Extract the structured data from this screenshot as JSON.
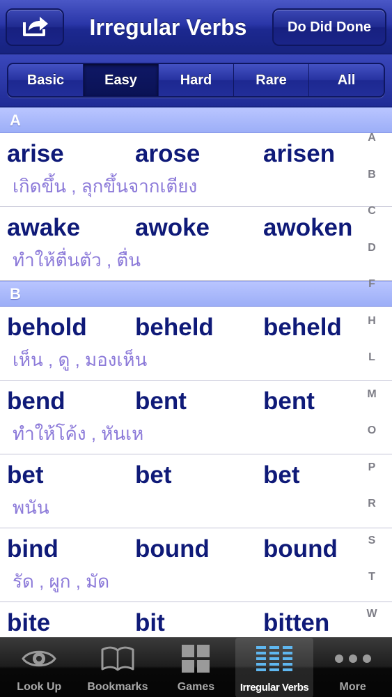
{
  "navbar": {
    "title": "Irregular Verbs",
    "share_icon": "share-arrow-icon",
    "right_button": "Do Did Done"
  },
  "segments": [
    {
      "label": "Basic",
      "selected": false
    },
    {
      "label": "Easy",
      "selected": true
    },
    {
      "label": "Hard",
      "selected": false
    },
    {
      "label": "Rare",
      "selected": false
    },
    {
      "label": "All",
      "selected": false
    }
  ],
  "sections": [
    {
      "letter": "A",
      "rows": [
        {
          "base": "arise",
          "past": "arose",
          "participle": "arisen",
          "meaning": "เกิดขึ้น , ลุกขึ้นจากเตียง"
        },
        {
          "base": "awake",
          "past": "awoke",
          "participle": "awoken",
          "meaning": "ทำให้ตื่นตัว , ตื่น"
        }
      ]
    },
    {
      "letter": "B",
      "rows": [
        {
          "base": "behold",
          "past": "beheld",
          "participle": "beheld",
          "meaning": "เห็น , ดู , มองเห็น"
        },
        {
          "base": "bend",
          "past": "bent",
          "participle": "bent",
          "meaning": "ทำให้โค้ง , หันเห"
        },
        {
          "base": "bet",
          "past": "bet",
          "participle": "bet",
          "meaning": "พนัน"
        },
        {
          "base": "bind",
          "past": "bound",
          "participle": "bound",
          "meaning": "รัด , ผูก , มัด"
        },
        {
          "base": "bite",
          "past": "bit",
          "participle": "bitten",
          "meaning": ""
        }
      ]
    }
  ],
  "index": [
    "A",
    "B",
    "C",
    "D",
    "F",
    "H",
    "L",
    "M",
    "O",
    "P",
    "R",
    "S",
    "T",
    "W"
  ],
  "tabs": [
    {
      "label": "Look Up",
      "icon": "eye-icon",
      "selected": false
    },
    {
      "label": "Bookmarks",
      "icon": "book-icon",
      "selected": false
    },
    {
      "label": "Games",
      "icon": "grid-icon",
      "selected": false
    },
    {
      "label": "Irregular Verbs",
      "icon": "list-columns-icon",
      "selected": true
    },
    {
      "label": "More",
      "icon": "more-dots-icon",
      "selected": false
    }
  ],
  "colors": {
    "nav_blue": "#1f2a8f",
    "verb_text": "#0f1a78",
    "meaning_text": "#8c7ad9",
    "section_header": "#a8b7fa"
  }
}
